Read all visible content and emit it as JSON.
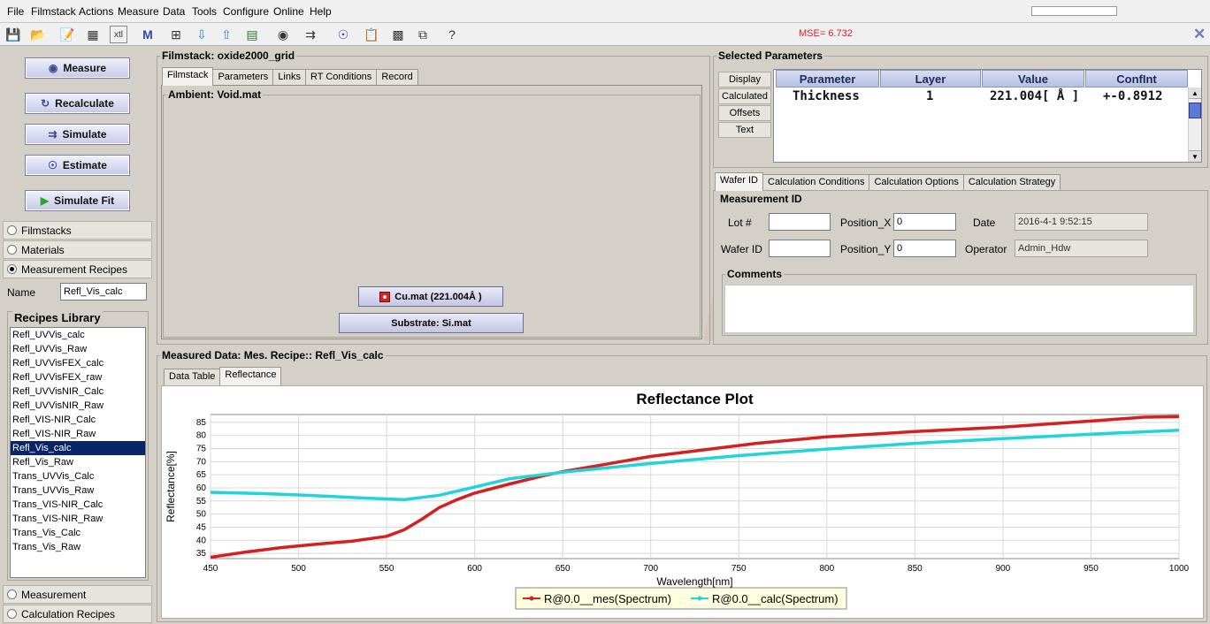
{
  "menu": [
    "File",
    "Filmstack",
    "Actions",
    "Measure",
    "Data",
    "Tools",
    "Configure",
    "Online",
    "Help"
  ],
  "status": {
    "mse": "MSE= 6.732"
  },
  "left": {
    "buttons": {
      "measure": "Measure",
      "recalculate": "Recalculate",
      "simulate": "Simulate",
      "estimate": "Estimate",
      "simulate_fit": "Simulate Fit"
    },
    "nav": {
      "filmstacks": "Filmstacks",
      "materials": "Materials",
      "measurement_recipes": "Measurement Recipes",
      "measurement": "Measurement",
      "calculation_recipes": "Calculation Recipes"
    },
    "name_label": "Name",
    "name_value": "Refl_Vis_calc",
    "recipes_title": "Recipes Library",
    "recipes": [
      "Refl_UVVis_calc",
      "Refl_UVVis_Raw",
      "Refl_UVVisFEX_calc",
      "Refl_UVVisFEX_raw",
      "Refl_UVVisNIR_Calc",
      "Refl_UVVisNIR_Raw",
      "Refl_VIS-NIR_Calc",
      "Refl_VIS-NIR_Raw",
      "Refl_Vis_calc",
      "Refl_Vis_Raw",
      "Trans_UVVis_Calc",
      "Trans_UVVis_Raw",
      "Trans_VIS-NIR_Calc",
      "Trans_VIS-NIR_Raw",
      "Trans_Vis_Calc",
      "Trans_Vis_Raw"
    ],
    "selected_recipe": "Refl_Vis_calc"
  },
  "filmstack": {
    "title": "Filmstack: oxide2000_grid",
    "tabs": [
      "Filmstack",
      "Parameters",
      "Links",
      "RT Conditions",
      "Record"
    ],
    "ambient": "Ambient: Void.mat",
    "layer": "Cu.mat (221.004Å )",
    "substrate": "Substrate: Si.mat"
  },
  "selected_params": {
    "title": "Selected Parameters",
    "side_tabs": [
      "Display",
      "Calculated",
      "Offsets",
      "Text"
    ],
    "headers": [
      "Parameter",
      "Layer",
      "Value",
      "ConfInt"
    ],
    "rows": [
      [
        "Thickness",
        "1",
        "221.004[ Å ]",
        "+-0.8912"
      ]
    ]
  },
  "wafer": {
    "tabs": [
      "Wafer ID",
      "Calculation Conditions",
      "Calculation Options",
      "Calculation Strategy"
    ],
    "section": "Measurement ID",
    "lot_label": "Lot #",
    "lot_value": "",
    "wafer_label": "Wafer ID",
    "wafer_value": "",
    "posx_label": "Position_X",
    "posx_value": "0",
    "posy_label": "Position_Y",
    "posy_value": "0",
    "date_label": "Date",
    "date_value": "2016-4-1 9:52:15",
    "operator_label": "Operator",
    "operator_value": "Admin_Hdw",
    "comments_label": "Comments"
  },
  "measured": {
    "title": "Measured Data: Mes. Recipe:: Refl_Vis_calc",
    "tabs": [
      "Data Table",
      "Reflectance"
    ]
  },
  "chart_data": {
    "type": "line",
    "title": "Reflectance Plot",
    "xlabel": "Wavelength[nm]",
    "ylabel": "Reflectance[%]",
    "xlim": [
      450,
      1000
    ],
    "ylim": [
      33,
      88
    ],
    "xticks": [
      450,
      500,
      550,
      600,
      650,
      700,
      750,
      800,
      850,
      900,
      950,
      1000
    ],
    "yticks": [
      35,
      40,
      45,
      50,
      55,
      60,
      65,
      70,
      75,
      80,
      85
    ],
    "grid": true,
    "legend_position": "bottom",
    "series": [
      {
        "name": "R@0.0__mes(Spectrum)",
        "color": "#d42020",
        "x": [
          450,
          470,
          490,
          510,
          530,
          550,
          560,
          570,
          580,
          590,
          600,
          620,
          640,
          650,
          670,
          700,
          730,
          760,
          800,
          850,
          900,
          950,
          980,
          1000
        ],
        "y": [
          33.5,
          35.5,
          37.2,
          38.5,
          39.6,
          41.5,
          44,
          48,
          52.5,
          55.5,
          58,
          61.5,
          64.8,
          66.2,
          68.5,
          72,
          74.5,
          77,
          79.5,
          81.5,
          83.2,
          85.5,
          87,
          87.2
        ]
      },
      {
        "name": "R@0.0__calc(Spectrum)",
        "color": "#20d4d8",
        "x": [
          450,
          480,
          500,
          520,
          540,
          560,
          580,
          600,
          620,
          650,
          700,
          750,
          800,
          850,
          900,
          950,
          1000
        ],
        "y": [
          58.3,
          57.8,
          57.3,
          56.7,
          56,
          55.5,
          57.2,
          60.3,
          63.5,
          66,
          69.3,
          72.3,
          74.8,
          77,
          78.8,
          80.5,
          82
        ]
      }
    ]
  }
}
